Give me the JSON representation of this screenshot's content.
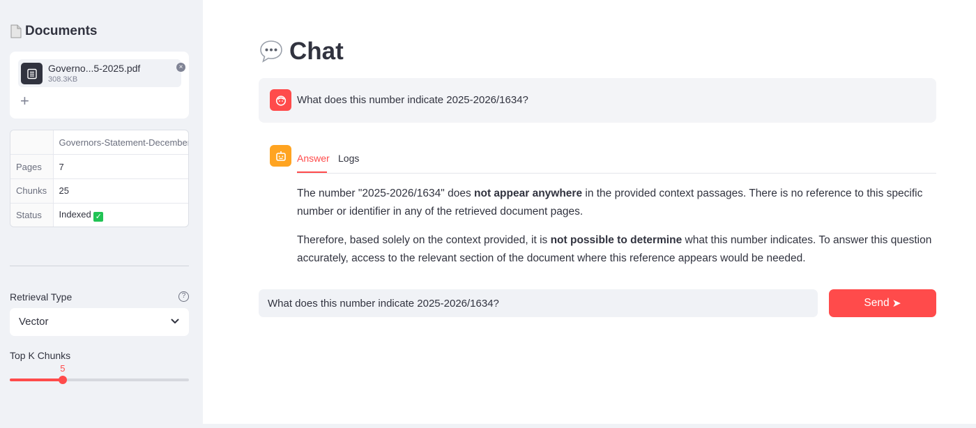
{
  "sidebar": {
    "title": "Documents",
    "title_icon": "page-icon",
    "uploader": {
      "file_name": "Governo...5-2025.pdf",
      "file_size": "308.3KB",
      "add_icon": "+"
    },
    "doc_table": {
      "column_header": "Governors-Statement-December",
      "rows": [
        {
          "label": "Pages",
          "value": "7"
        },
        {
          "label": "Chunks",
          "value": "25"
        },
        {
          "label": "Status",
          "value": "Indexed",
          "badge": "✓"
        }
      ]
    },
    "retrieval_type": {
      "label": "Retrieval Type",
      "help": "?",
      "selected": "Vector"
    },
    "top_k": {
      "label": "Top K Chunks",
      "value": "5",
      "fraction": 0.295
    }
  },
  "main": {
    "title": "Chat",
    "title_icon": "speech-bubble-icon",
    "user_message": "What does this number indicate 2025-2026/1634?",
    "tabs": [
      {
        "label": "Answer",
        "active": true
      },
      {
        "label": "Logs",
        "active": false
      }
    ],
    "answer": {
      "p1": {
        "a": "The number \"2025-2026/1634\" does ",
        "b": "not appear anywhere",
        "c": " in the provided context passages. There is no reference to this specific number or identifier in any of the retrieved document pages."
      },
      "p2": {
        "a": "Therefore, based solely on the context provided, it is ",
        "b": "not possible to determine",
        "c": " what this number indicates. To answer this question accurately, access to the relevant section of the document where this reference appears would be needed."
      }
    },
    "input": {
      "value": "What does this number indicate 2025-2026/1634?"
    },
    "send": {
      "label": "Send",
      "icon": "➤"
    }
  },
  "colors": {
    "accent": "#ff4b4b",
    "bot_avatar": "#ffa421",
    "sidebar_bg": "#f0f2f6",
    "success": "#21c354"
  }
}
